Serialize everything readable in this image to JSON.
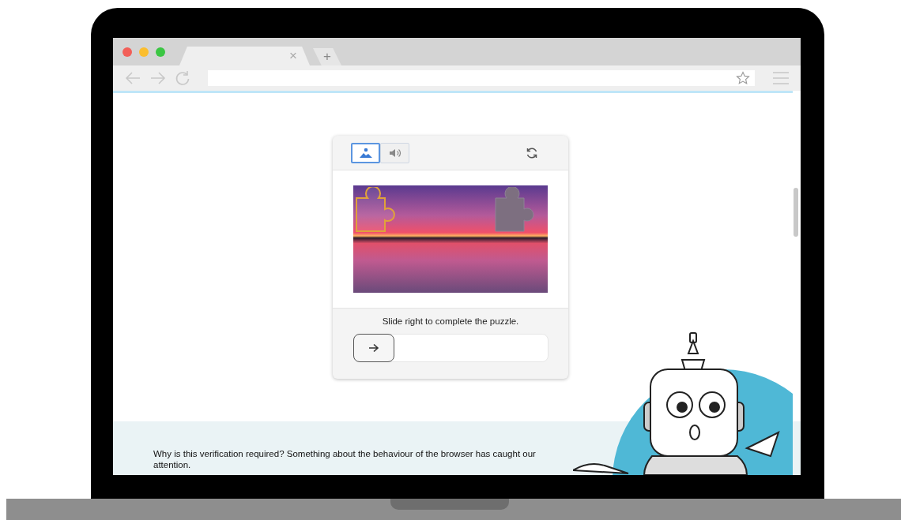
{
  "browser": {
    "tab_close": "×",
    "new_tab": "+"
  },
  "challenge": {
    "modes": [
      {
        "kind": "image",
        "selected": true
      },
      {
        "kind": "audio",
        "selected": false
      }
    ],
    "instruction": "Slide right to complete the puzzle.",
    "slider": {
      "level": 0
    }
  },
  "notice": "Why is this verification required? Something about the behaviour of the browser has caught our attention."
}
